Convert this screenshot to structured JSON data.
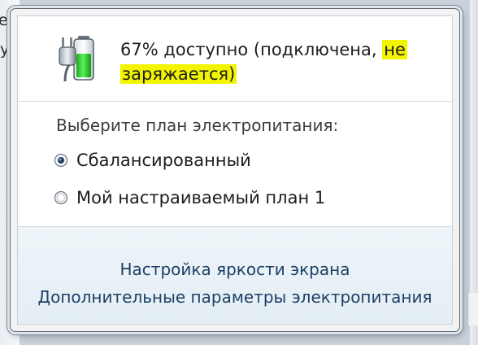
{
  "background": {
    "text_fragments": [
      "ер",
      "у"
    ]
  },
  "battery": {
    "icon": "battery-charging-plug-icon",
    "status_line1": "67% доступно (подключена, ",
    "status_highlight_a": "не",
    "status_highlight_b": "заряжается)",
    "level": 0.67,
    "highlight_color": "#f3f400",
    "fill_color": "#27c927"
  },
  "power_plans": {
    "heading": "Выберите план электропитания:",
    "items": [
      {
        "label": "Сбалансированный",
        "selected": true
      },
      {
        "label": "Мой настраиваемый план 1",
        "selected": false
      }
    ]
  },
  "links": {
    "brightness": "Настройка яркости экрана",
    "more_options": "Дополнительные параметры электропитания"
  }
}
